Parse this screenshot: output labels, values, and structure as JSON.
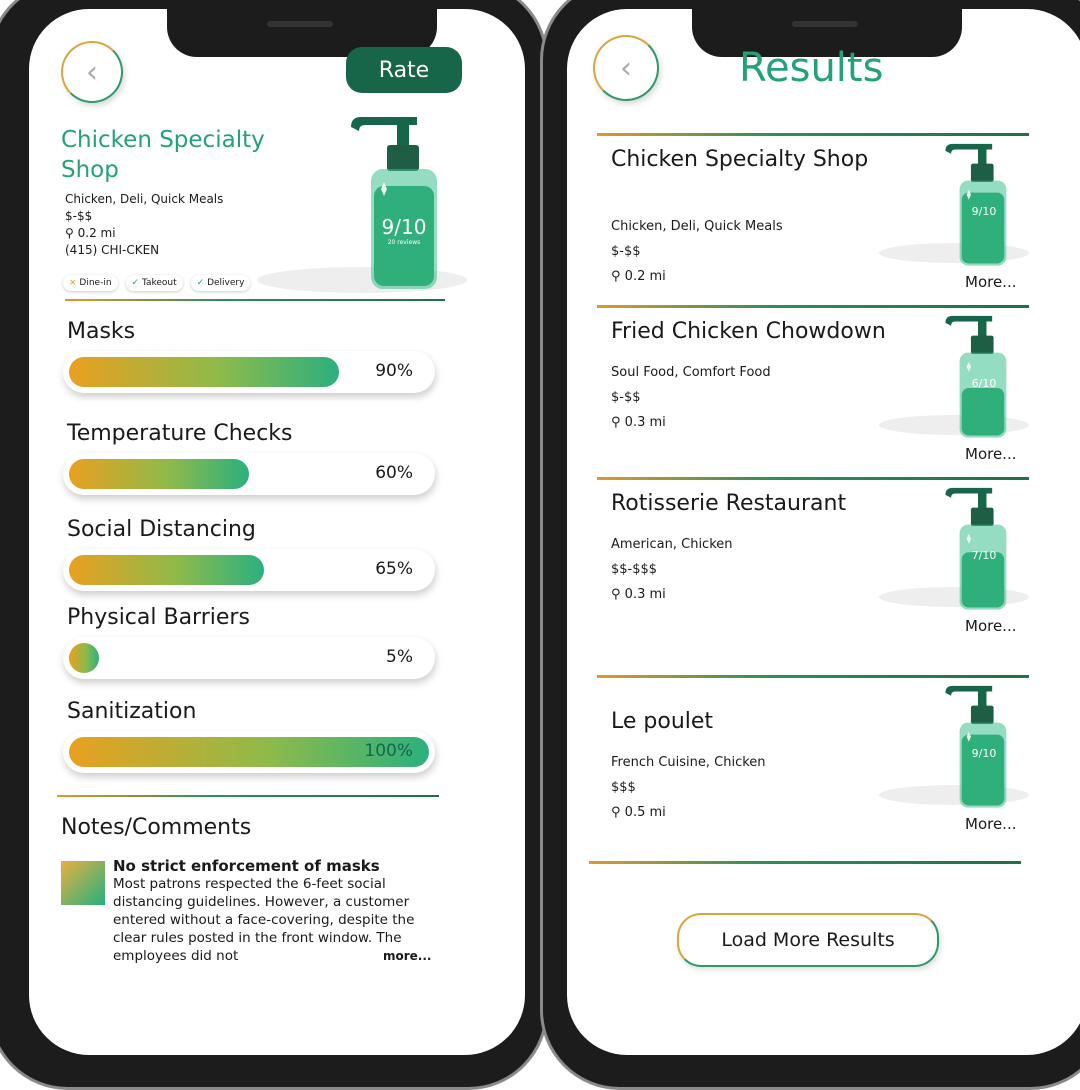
{
  "detail": {
    "rate_label": "Rate",
    "name": "Chicken Specialty Shop",
    "cuisine": "Chicken, Deli, Quick Meals",
    "price": "$-$$",
    "distance": "0.2 mi",
    "phone": "(415) CHI-CKEN",
    "rating": "9/10",
    "rating_value": 9,
    "reviews": "20 reviews",
    "services": [
      {
        "icon": "x-icon",
        "mark": "×",
        "label": "Dine-in",
        "available": false
      },
      {
        "icon": "check-icon",
        "mark": "✓",
        "label": "Takeout",
        "available": true
      },
      {
        "icon": "check-icon",
        "mark": "✓",
        "label": "Delivery",
        "available": true
      }
    ],
    "metrics": [
      {
        "label": "Masks",
        "percent": 90,
        "text": "90%"
      },
      {
        "label": "Temperature Checks",
        "percent": 60,
        "text": "60%"
      },
      {
        "label": "Social Distancing",
        "percent": 65,
        "text": "65%"
      },
      {
        "label": "Physical Barriers",
        "percent": 5,
        "text": "5%"
      },
      {
        "label": "Sanitization",
        "percent": 100,
        "text": "100%"
      }
    ],
    "notes_title": "Notes/Comments",
    "note_title": "No strict enforcement of masks",
    "note_body": "Most patrons respected the 6-feet social distancing guidelines. However, a customer entered without a face-covering, despite the clear rules posted in the front window. The employees did not",
    "note_more": "more..."
  },
  "results": {
    "title": "Results",
    "items": [
      {
        "name": "Chicken Specialty Shop",
        "cuisine": "Chicken, Deli, Quick Meals",
        "price": "$-$$",
        "distance": "0.2 mi",
        "rating": "9/10",
        "rating_value": 9,
        "more": "More..."
      },
      {
        "name": "Fried Chicken Chowdown",
        "cuisine": "Soul Food, Comfort Food",
        "price": "$-$$",
        "distance": "0.3 mi",
        "rating": "6/10",
        "rating_value": 6,
        "more": "More..."
      },
      {
        "name": "Rotisserie Restaurant",
        "cuisine": "American, Chicken",
        "price": "$$-$$$",
        "distance": "0.3 mi",
        "rating": "7/10",
        "rating_value": 7,
        "more": "More..."
      },
      {
        "name": "Le poulet",
        "cuisine": "French Cuisine, Chicken",
        "price": "$$$",
        "distance": "0.5 mi",
        "rating": "9/10",
        "rating_value": 9,
        "more": "More..."
      }
    ],
    "load_more": "Load More Results"
  },
  "colors": {
    "accent": "#24a276",
    "dark_green": "#17664a",
    "orange": "#e9a020"
  }
}
